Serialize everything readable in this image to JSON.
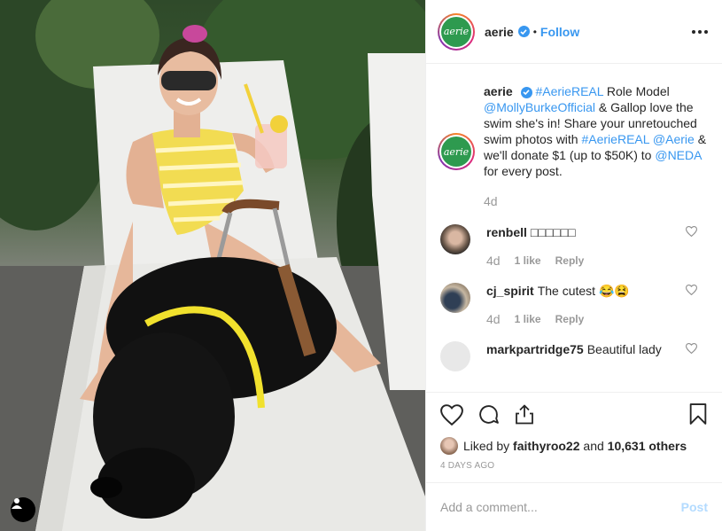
{
  "header": {
    "username": "aerie",
    "avatar_text": "aerie",
    "separator": "•",
    "follow_label": "Follow",
    "more_icon": "more-options-icon"
  },
  "caption": {
    "username": "aerie",
    "segments": [
      {
        "text": "#AerieREAL",
        "link": true
      },
      {
        "text": " Role Model ",
        "link": false
      },
      {
        "text": "@MollyBurkeOfficial",
        "link": true
      },
      {
        "text": " & Gallop love the swim she's in! Share your unretouched swim photos with ",
        "link": false
      },
      {
        "text": "#AerieREAL",
        "link": true
      },
      {
        "text": " ",
        "link": false
      },
      {
        "text": "@Aerie",
        "link": true
      },
      {
        "text": " & we'll donate $1 (up to $50K) to ",
        "link": false
      },
      {
        "text": "@NEDA",
        "link": true
      },
      {
        "text": " for every post.",
        "link": false
      }
    ],
    "time": "4d"
  },
  "comments": [
    {
      "username": "renbell",
      "text": "□□□□□□",
      "time": "4d",
      "likes": "1 like",
      "reply": "Reply"
    },
    {
      "username": "cj_spirit",
      "text": "The cutest 😂😫",
      "time": "4d",
      "likes": "1 like",
      "reply": "Reply"
    },
    {
      "username": "markpartridge75",
      "text": "Beautiful lady",
      "time": "",
      "likes": "",
      "reply": ""
    }
  ],
  "likes": {
    "prefix": "Liked by ",
    "user": "faithyroo22",
    "middle": " and ",
    "count": "10,631 others"
  },
  "date": "4 DAYS AGO",
  "add_comment": {
    "placeholder": "Add a comment...",
    "post_label": "Post"
  },
  "colors": {
    "link": "#3897f0",
    "brand_green": "#2e9a4f",
    "post_disabled": "#b3dbff"
  }
}
